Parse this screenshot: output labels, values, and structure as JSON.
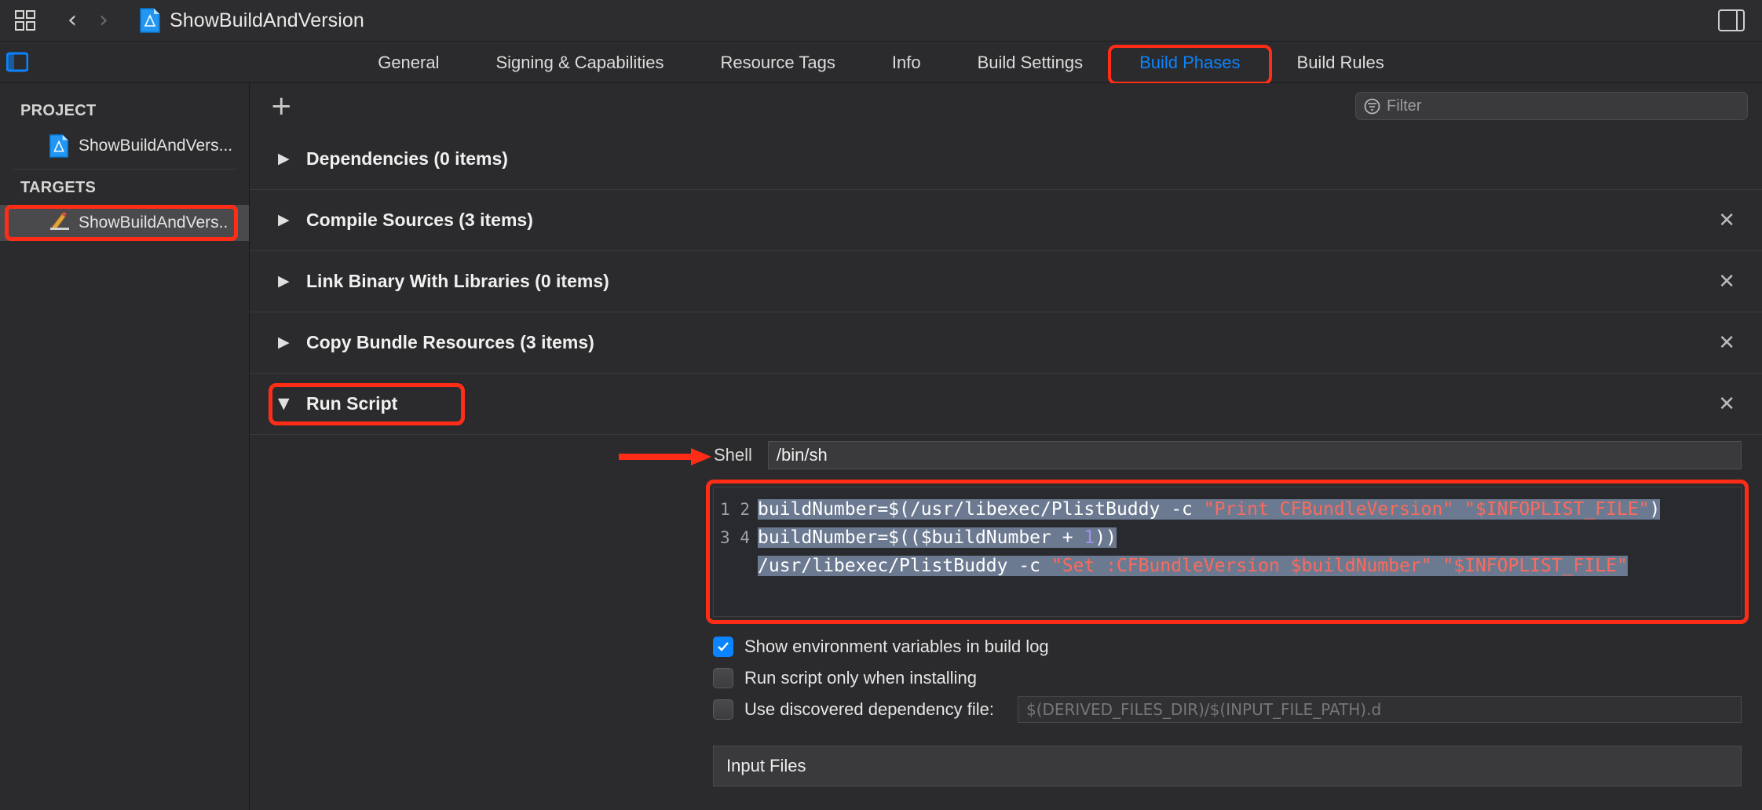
{
  "toolbar": {
    "grid_icon": "grid-icon",
    "back_chevron": "‹",
    "forward_chevron": "›",
    "doc_icon": "xcode-project-icon",
    "title": "ShowBuildAndVersion",
    "layout_icon": "editor-layout-icon"
  },
  "tabs": [
    {
      "label": "General",
      "selected": false
    },
    {
      "label": "Signing & Capabilities",
      "selected": false
    },
    {
      "label": "Resource Tags",
      "selected": false
    },
    {
      "label": "Info",
      "selected": false
    },
    {
      "label": "Build Settings",
      "selected": false
    },
    {
      "label": "Build Phases",
      "selected": true
    },
    {
      "label": "Build Rules",
      "selected": false
    }
  ],
  "sidebar": {
    "project_label": "PROJECT",
    "project_items": [
      {
        "label": "ShowBuildAndVers...",
        "icon": "xcode-project-icon"
      }
    ],
    "targets_label": "TARGETS",
    "target_items": [
      {
        "label": "ShowBuildAndVers..",
        "icon": "app-target-icon"
      }
    ]
  },
  "main": {
    "add_button": "+",
    "filter": {
      "placeholder": "Filter",
      "icon": "filter-icon"
    },
    "phases": [
      {
        "title": "Dependencies (0 items)",
        "disclosure": "▶",
        "closable": false
      },
      {
        "title": "Compile Sources (3 items)",
        "disclosure": "▶",
        "closable": true
      },
      {
        "title": "Link Binary With Libraries (0 items)",
        "disclosure": "▶",
        "closable": true
      },
      {
        "title": "Copy Bundle Resources (3 items)",
        "disclosure": "▶",
        "closable": true
      },
      {
        "title": "Run Script",
        "disclosure": "▼",
        "closable": true
      }
    ],
    "run_script": {
      "shell_label": "Shell",
      "shell_value": "/bin/sh",
      "line_numbers": [
        "1",
        "2",
        "3",
        "4"
      ],
      "code_lines": [
        "buildNumber=$(/usr/libexec/PlistBuddy -c \"Print CFBundleVersion\" \"$INFOPLIST_FILE\")",
        "buildNumber=$(($buildNumber + 1))",
        "/usr/libexec/PlistBuddy -c \"Set :CFBundleVersion $buildNumber\" \"$INFOPLIST_FILE\"",
        ""
      ],
      "checkboxes": [
        {
          "label": "Show environment variables in build log",
          "checked": true
        },
        {
          "label": "Run script only when installing",
          "checked": false
        },
        {
          "label": "Use discovered dependency file:",
          "checked": false
        }
      ],
      "dependency_file_placeholder": "$(DERIVED_FILES_DIR)/$(INPUT_FILE_PATH).d",
      "input_files_label": "Input Files"
    }
  },
  "annotations": {
    "highlight_color": "#ff2d18",
    "arrow": "red-arrow-pointing-right"
  },
  "colors": {
    "accent_blue": "#0a84ff",
    "string_red": "#fc6a5d",
    "number_purple": "#a08fee",
    "selection_blue_gray": "#6c7a91",
    "background": "#2b2b2d"
  }
}
